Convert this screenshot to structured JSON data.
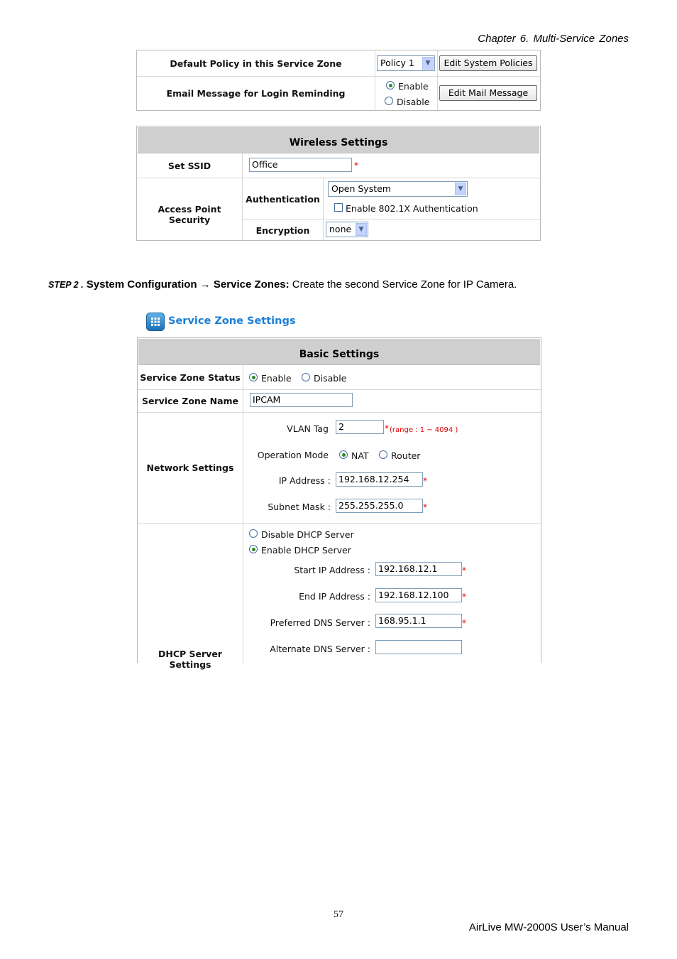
{
  "header": {
    "chapter": "Chapter  6.   Multi-Service  Zones"
  },
  "policy_table": {
    "default_policy_label": "Default Policy in this Service Zone",
    "policy_value": "Policy 1",
    "edit_policies_button": "Edit System Policies",
    "email_label": "Email Message for Login Reminding",
    "enable_label": "Enable",
    "disable_label": "Disable",
    "email_selected": "Enable",
    "edit_mail_button": "Edit Mail Message"
  },
  "wireless": {
    "title": "Wireless Settings",
    "ssid_label": "Set SSID",
    "ssid_value": "Office",
    "required_mark": "*",
    "ap_security_label": "Access Point Security",
    "auth_label": "Authentication",
    "auth_value": "Open System",
    "enable_8021x_label": "Enable 802.1X Authentication",
    "enable_8021x_checked": false,
    "encryption_label": "Encryption",
    "encryption_value": "none"
  },
  "step": {
    "prefix": "STEP 2 .",
    "bold_text": "System Configuration → Service Zones:",
    "rest_text": " Create the second Service Zone for IP Camera."
  },
  "service_zone": {
    "title": "Service Zone Settings",
    "icon": "grid-app-icon",
    "basic_title": "Basic Settings",
    "status_label": "Service Zone Status",
    "status_enable": "Enable",
    "status_disable": "Disable",
    "status_selected": "Enable",
    "name_label": "Service Zone Name",
    "name_value": "IPCAM",
    "network_label": "Network Settings",
    "vlan_label": "VLAN Tag",
    "vlan_value": "2",
    "vlan_range": "(range : 1 ~ 4094 )",
    "mode_label": "Operation Mode",
    "mode_nat": "NAT",
    "mode_router": "Router",
    "mode_selected": "NAT",
    "ip_label": "IP Address :",
    "ip_value": "192.168.12.254",
    "mask_label": "Subnet Mask :",
    "mask_value": "255.255.255.0",
    "dhcp_label": "DHCP Server Settings",
    "dhcp_disable": "Disable DHCP Server",
    "dhcp_enable": "Enable DHCP Server",
    "dhcp_selected": "Enable",
    "start_ip_label": "Start IP Address :",
    "start_ip_value": "192.168.12.1",
    "end_ip_label": "End IP Address :",
    "end_ip_value": "192.168.12.100",
    "pref_dns_label": "Preferred DNS Server :",
    "pref_dns_value": "168.95.1.1",
    "alt_dns_label": "Alternate DNS Server :",
    "alt_dns_value": ""
  },
  "footer": {
    "page_number": "57",
    "manual": "AirLive  MW-2000S  User’s  Manual"
  }
}
